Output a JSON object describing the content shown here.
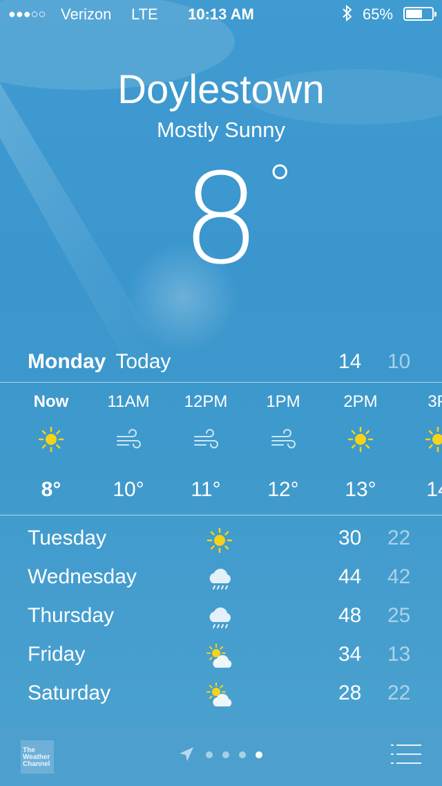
{
  "status": {
    "signal": "●●●○○",
    "carrier": "Verizon",
    "network": "LTE",
    "time": "10:13 AM",
    "battery": "65%",
    "battery_level": 0.65
  },
  "location": {
    "city": "Doylestown",
    "condition": "Mostly Sunny",
    "temperature": "8",
    "degree": "°"
  },
  "today": {
    "day": "Monday",
    "label": "Today",
    "high": "14",
    "low": "10"
  },
  "hourly": [
    {
      "time": "Now",
      "icon": "sun-icon",
      "temp": "8°"
    },
    {
      "time": "11AM",
      "icon": "wind-icon",
      "temp": "10°"
    },
    {
      "time": "12PM",
      "icon": "wind-icon",
      "temp": "11°"
    },
    {
      "time": "1PM",
      "icon": "wind-icon",
      "temp": "12°"
    },
    {
      "time": "2PM",
      "icon": "sun-icon",
      "temp": "13°"
    },
    {
      "time": "3P",
      "icon": "sun-icon",
      "temp": "14"
    }
  ],
  "forecast": [
    {
      "day": "Tuesday",
      "icon": "sun-icon",
      "high": "30",
      "low": "22"
    },
    {
      "day": "Wednesday",
      "icon": "rain-cloud-icon",
      "high": "44",
      "low": "42"
    },
    {
      "day": "Thursday",
      "icon": "rain-cloud-icon",
      "high": "48",
      "low": "25"
    },
    {
      "day": "Friday",
      "icon": "partly-cloudy-icon",
      "high": "34",
      "low": "13"
    },
    {
      "day": "Saturday",
      "icon": "partly-cloudy-icon",
      "high": "28",
      "low": "22"
    }
  ],
  "footer": {
    "logo": "The Weather Channel",
    "page_count": 4,
    "active_page": 4
  },
  "colors": {
    "sun": "#f7d21a",
    "text_dim": "rgba(255,255,255,0.55)"
  }
}
